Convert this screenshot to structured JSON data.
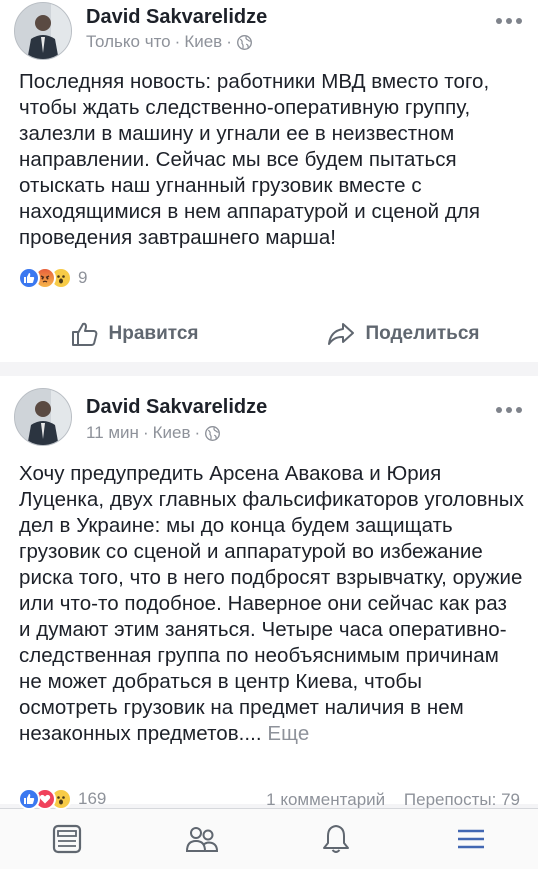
{
  "posts": [
    {
      "author": "David Sakvarelidze",
      "time": "Только что",
      "location": "Киев",
      "text": "Последняя новость: работники МВД вместо того, чтобы ждать следственно-оперативную группу, залезли в машину и угнали ее в неизвестном направлении. Сейчас мы все будем пытаться отыскать наш угнанный грузовик вместе с находящимися в нем аппаратурой и сценой для проведения завтрашнего марша!",
      "reaction_count": "9",
      "reactions": [
        "like-icon",
        "angry-icon",
        "wow-icon"
      ],
      "like_label": "Нравится",
      "share_label": "Поделиться"
    },
    {
      "author": "David Sakvarelidze",
      "time": "11 мин",
      "location": "Киев",
      "text": "Хочу предупредить Арсена Авакова и Юрия Луценка, двух главных фальсификаторов уголовных дел в Украине: мы до конца будем защищать грузовик со сценой и аппаратурой во избежание риска того, что в него подбросят взрывчатку, оружие или что-то подобное. Наверное они сейчас как раз и думают этим заняться. Четыре часа оперативно-следственная группа по необъяснимым причинам не может добраться в центр Киева, чтобы осмотреть грузовик на предмет наличия в нем незаконных предметов....",
      "more_label": "Еще",
      "reaction_count": "169",
      "reactions": [
        "like-icon",
        "love-icon",
        "wow-icon"
      ],
      "comments": "1 комментарий",
      "shares": "Перепосты: 79"
    }
  ],
  "meta_separator": "·",
  "tabbar": [
    "news-feed-icon",
    "friends-icon",
    "notifications-icon",
    "menu-icon"
  ],
  "colors": {
    "accent": "#4267b2",
    "text": "#1d2129",
    "secondary": "#8e929a",
    "action": "#606770"
  }
}
